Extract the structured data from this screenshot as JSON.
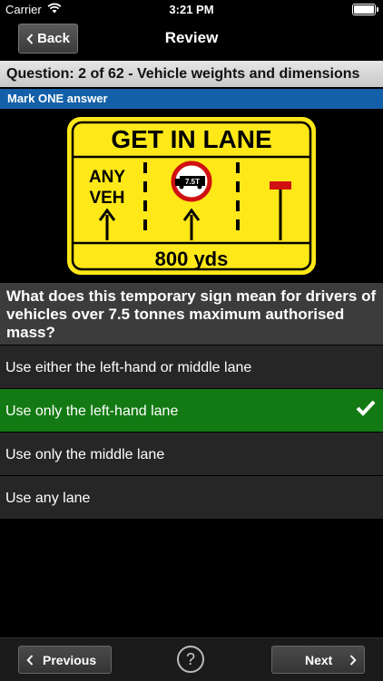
{
  "status_bar": {
    "carrier": "Carrier",
    "time": "3:21 PM"
  },
  "nav": {
    "back_label": "Back",
    "title": "Review"
  },
  "question_header": "Question: 2 of 62 - Vehicle weights and dimensions",
  "instruction": "Mark ONE answer",
  "sign": {
    "heading": "GET IN LANE",
    "line1": "ANY",
    "line2": "VEH",
    "weight": "7.5T",
    "distance": "800 yds",
    "colors": {
      "background": "#ffe818",
      "text": "#000000",
      "ring": "#d01010",
      "marker": "#d01010"
    }
  },
  "question_text": "What does this temporary sign mean for drivers of vehicles over 7.5 tonnes maximum authorised mass?",
  "answers": [
    {
      "label": "Use either the left-hand or middle lane",
      "correct": false
    },
    {
      "label": "Use only the left-hand lane",
      "correct": true
    },
    {
      "label": "Use only the middle lane",
      "correct": false
    },
    {
      "label": "Use any lane",
      "correct": false
    }
  ],
  "toolbar": {
    "previous_label": "Previous",
    "help_label": "?",
    "next_label": "Next"
  },
  "colors": {
    "correct": "#137a13",
    "instruction_bar": "#1460a8"
  }
}
